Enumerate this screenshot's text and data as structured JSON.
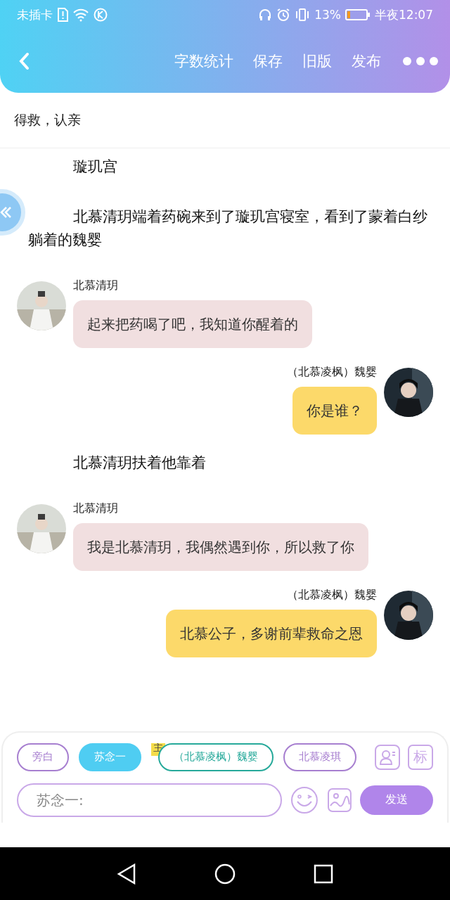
{
  "status_bar": {
    "carrier": "未插卡",
    "battery": "13%",
    "time": "半夜12:07"
  },
  "toolbar": {
    "actions": [
      "字数统计",
      "保存",
      "旧版",
      "发布"
    ]
  },
  "chapter_title": "得救，认亲",
  "messages": [
    {
      "kind": "narration",
      "text": "璇玑宫"
    },
    {
      "kind": "narration",
      "text": "北慕清玥端着药碗来到了璇玑宫寝室，看到了蒙着白纱躺着的魏婴"
    },
    {
      "kind": "left",
      "name": "北慕清玥",
      "text": "起来把药喝了吧，我知道你醒着的"
    },
    {
      "kind": "right",
      "name": "（北慕凌枫）魏婴",
      "text": "你是谁？"
    },
    {
      "kind": "narration",
      "text": "北慕清玥扶着他靠着"
    },
    {
      "kind": "left",
      "name": "北慕清玥",
      "text": "我是北慕清玥，我偶然遇到你，所以救了你"
    },
    {
      "kind": "right",
      "name": "（北慕凌枫）魏婴",
      "text": "北慕公子，多谢前辈救命之恩"
    }
  ],
  "roles": [
    {
      "label": "旁白",
      "selected": false,
      "color": "#a77fd0"
    },
    {
      "label": "苏念一",
      "selected": true,
      "color": "#4fcdf2"
    },
    {
      "label": "（北慕凌枫）魏婴",
      "selected": false,
      "color": "#26a99a",
      "badge": "主"
    },
    {
      "label": "北慕凌琪",
      "selected": false,
      "color": "#a77fd0"
    }
  ],
  "role_tools": [
    "标"
  ],
  "composer": {
    "placeholder": "苏念一:",
    "send": "发送"
  }
}
